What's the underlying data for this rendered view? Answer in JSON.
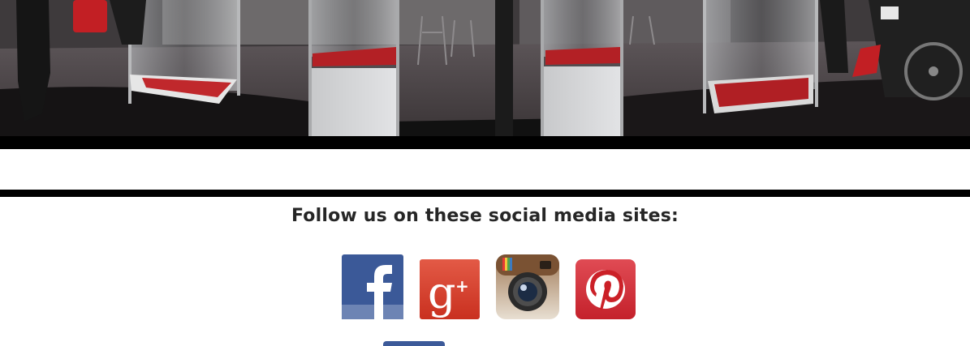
{
  "page": {
    "photo_alt": "",
    "social": {
      "heading": "Follow us on these social media sites:",
      "icons": [
        {
          "name": "facebook",
          "icon": "facebook-icon",
          "color": "#3b5998"
        },
        {
          "name": "google-plus",
          "icon": "google-plus-icon",
          "color": "#dd4b39"
        },
        {
          "name": "instagram",
          "icon": "instagram-icon",
          "color": "#8a5a3c"
        },
        {
          "name": "pinterest",
          "icon": "pinterest-icon",
          "color": "#cb2027"
        }
      ],
      "extra_icon_color": "#3c5a99"
    }
  }
}
